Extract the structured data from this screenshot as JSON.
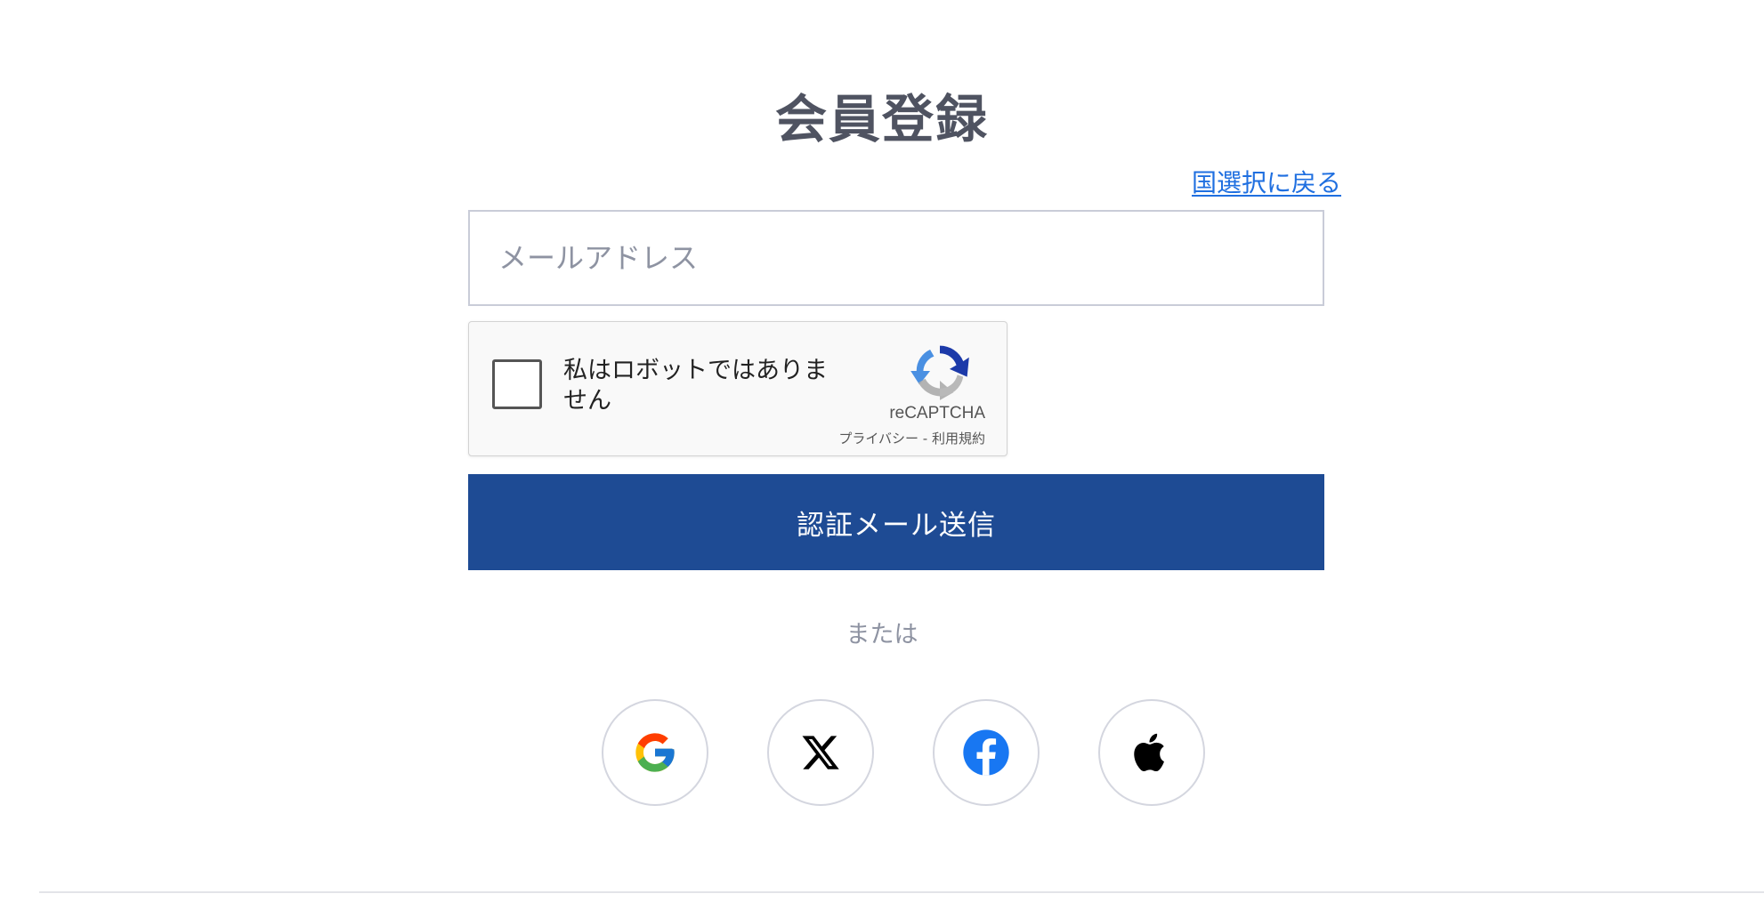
{
  "page": {
    "title": "会員登録",
    "back_link": "国選択に戻る"
  },
  "form": {
    "email_placeholder": "メールアドレス",
    "submit_label": "認証メール送信"
  },
  "recaptcha": {
    "label": "私はロボットではありません",
    "brand": "reCAPTCHA",
    "privacy": "プライバシー",
    "separator": " - ",
    "terms": "利用規約"
  },
  "social": {
    "separator_text": "または",
    "providers": [
      {
        "name": "Google",
        "icon": "google-icon"
      },
      {
        "name": "X",
        "icon": "x-icon"
      },
      {
        "name": "Facebook",
        "icon": "facebook-icon",
        "color": "#1877f2"
      },
      {
        "name": "Apple",
        "icon": "apple-icon",
        "color": "#000000"
      }
    ]
  },
  "colors": {
    "primary": "#1e4b94",
    "link": "#1f6fe0",
    "title": "#4f5361",
    "muted": "#8e93a2"
  }
}
